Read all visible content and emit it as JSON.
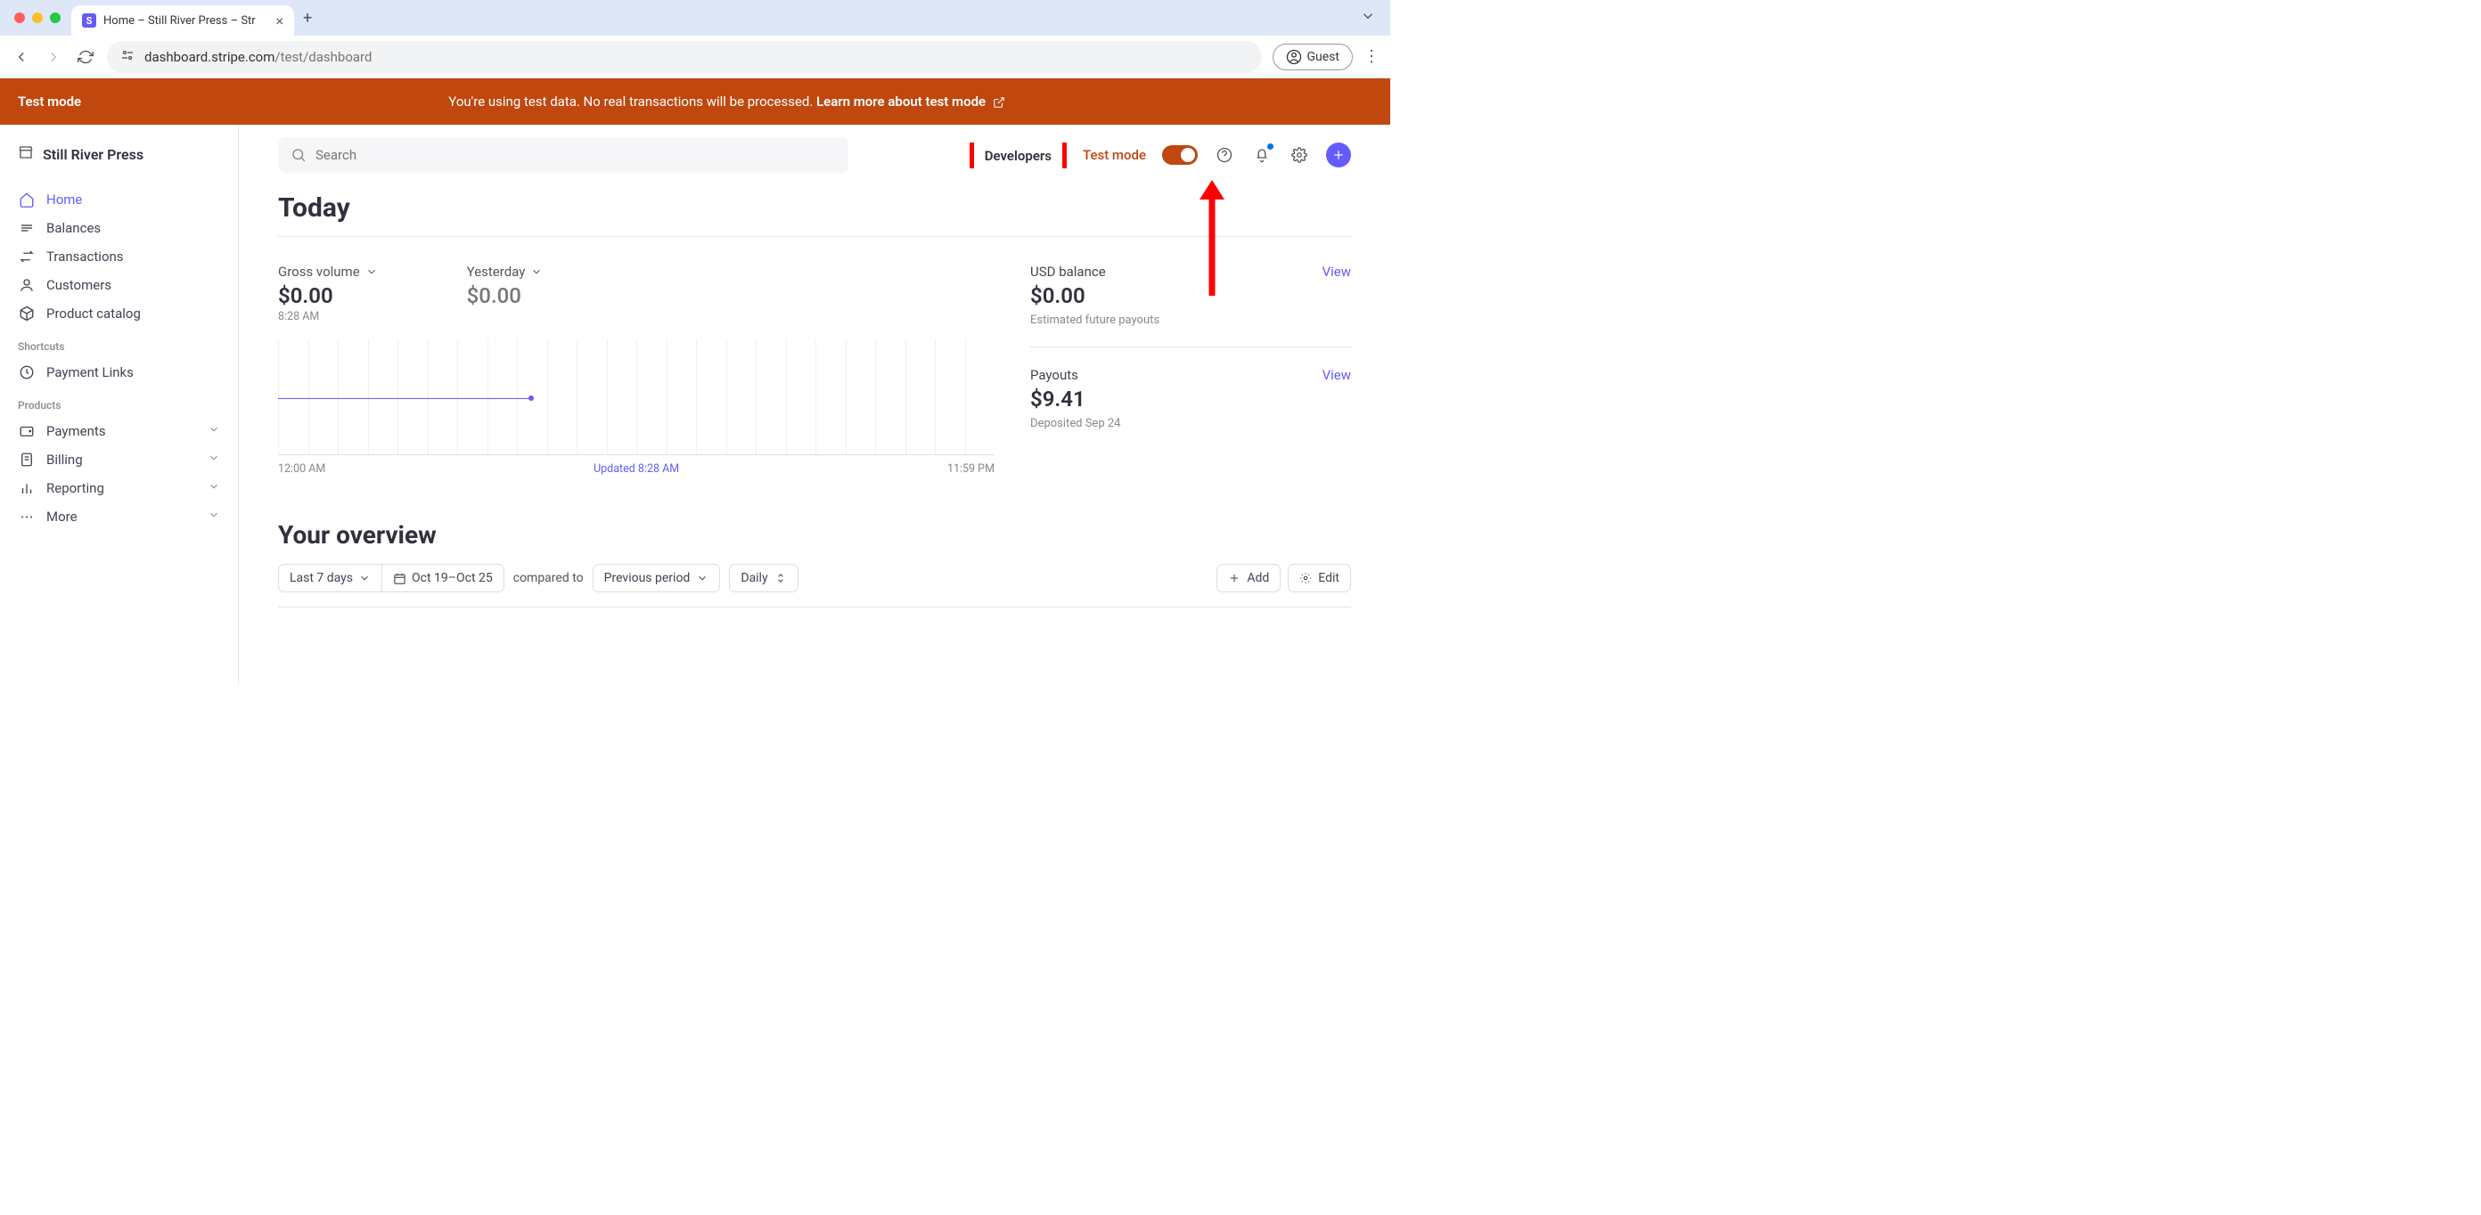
{
  "browser": {
    "tab_title": "Home – Still River Press – Str",
    "url_host": "dashboard.stripe.com",
    "url_path": "/test/dashboard",
    "guest_label": "Guest"
  },
  "banner": {
    "label": "Test mode",
    "message": "You're using test data. No real transactions will be processed. ",
    "link": "Learn more about test mode"
  },
  "sidebar": {
    "org": "Still River Press",
    "items": [
      {
        "label": "Home"
      },
      {
        "label": "Balances"
      },
      {
        "label": "Transactions"
      },
      {
        "label": "Customers"
      },
      {
        "label": "Product catalog"
      }
    ],
    "shortcuts_label": "Shortcuts",
    "shortcuts": [
      {
        "label": "Payment Links"
      }
    ],
    "products_label": "Products",
    "products": [
      {
        "label": "Payments"
      },
      {
        "label": "Billing"
      },
      {
        "label": "Reporting"
      },
      {
        "label": "More"
      }
    ]
  },
  "topbar": {
    "search_placeholder": "Search",
    "developers": "Developers",
    "testmode": "Test mode"
  },
  "page": {
    "title": "Today",
    "gross_label": "Gross volume",
    "gross_value": "$0.00",
    "gross_time": "8:28 AM",
    "yesterday_label": "Yesterday",
    "yesterday_value": "$0.00",
    "chart_start": "12:00 AM",
    "chart_updated": "Updated 8:28 AM",
    "chart_end": "11:59 PM",
    "usd_label": "USD balance",
    "usd_value": "$0.00",
    "usd_sub": "Estimated future payouts",
    "payouts_label": "Payouts",
    "payouts_value": "$9.41",
    "payouts_sub": "Deposited Sep 24",
    "view": "View"
  },
  "overview": {
    "title": "Your overview",
    "range": "Last 7 days",
    "dates": "Oct 19–Oct 25",
    "compared": "compared to",
    "previous": "Previous period",
    "daily": "Daily",
    "add": "Add",
    "edit": "Edit"
  },
  "chart_data": {
    "type": "line",
    "title": "Gross volume today",
    "x_start": "12:00 AM",
    "x_end": "11:59 PM",
    "series": [
      {
        "name": "Gross volume",
        "values": [
          0
        ],
        "note": "flat at $0.00 up to 8:28 AM"
      }
    ],
    "ylim": [
      0,
      0
    ]
  }
}
